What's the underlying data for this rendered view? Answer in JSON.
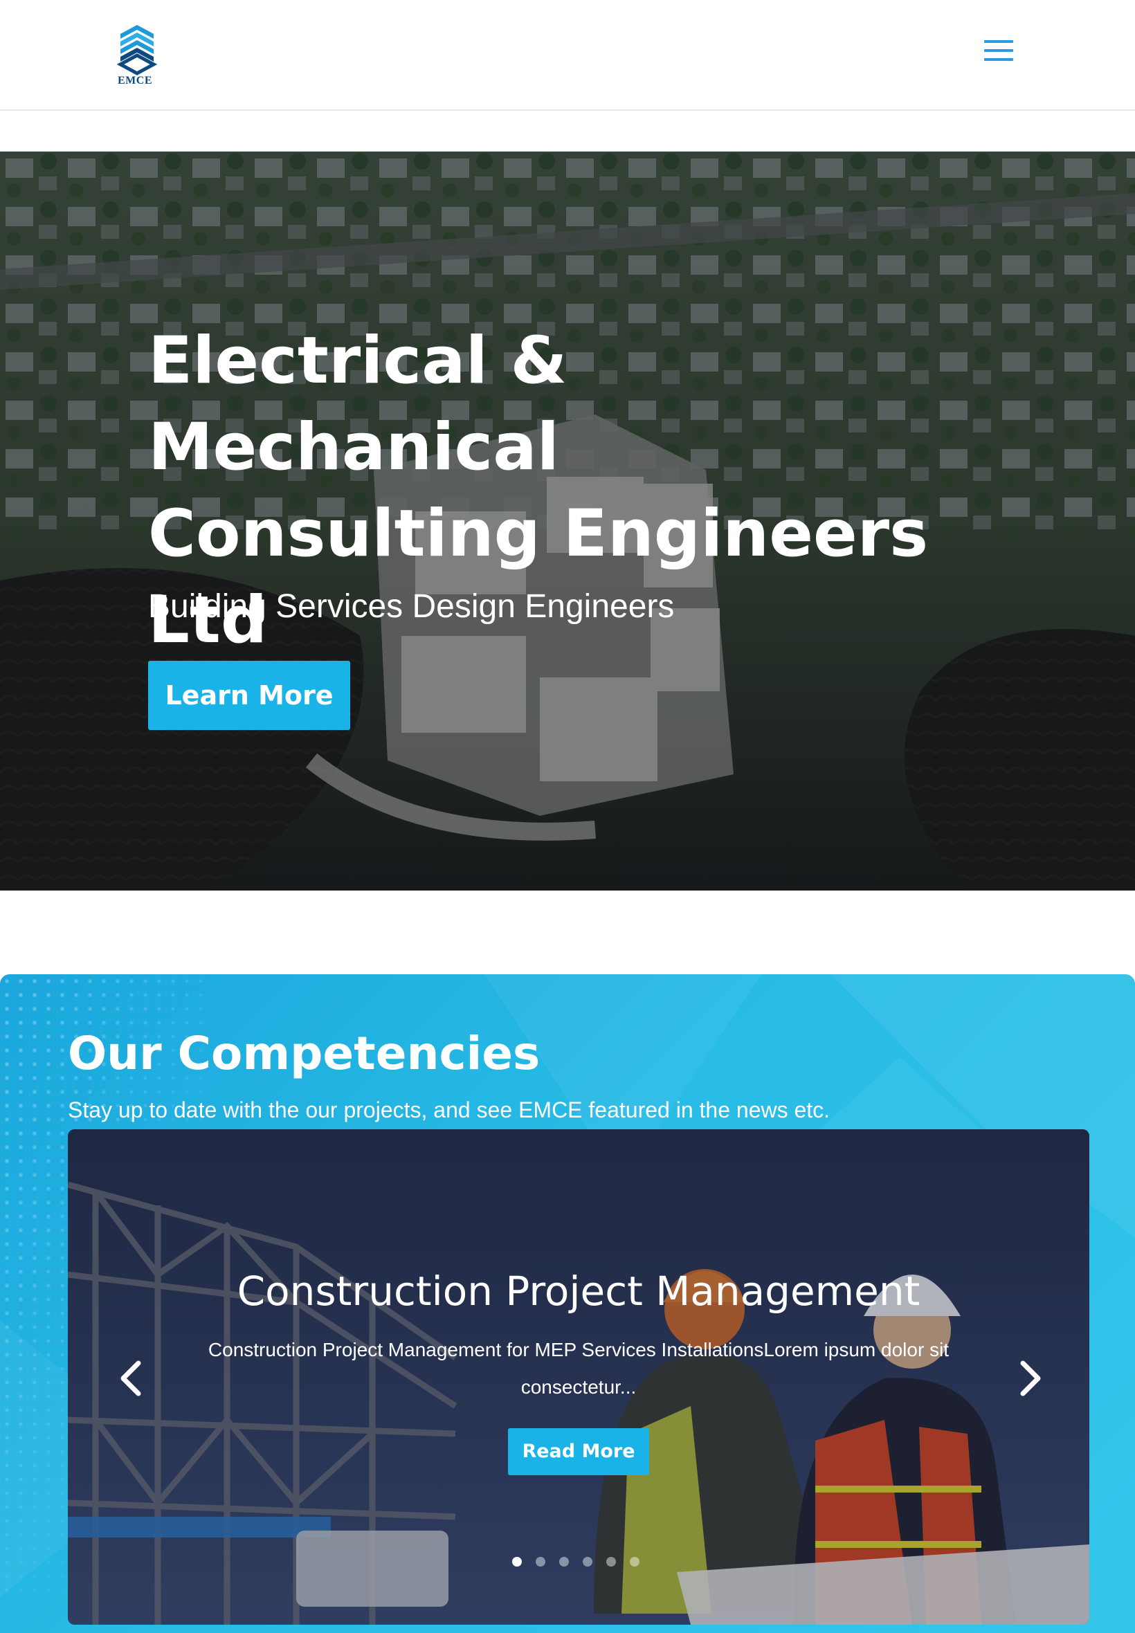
{
  "header": {
    "logo_text": "EMCE",
    "menu_icon": "hamburger-menu-icon"
  },
  "hero": {
    "title": "Electrical & Mechanical Consulting Engineers Ltd",
    "subtitle": "Building Services Design Engineers",
    "button_label": "Learn More"
  },
  "competencies": {
    "title": "Our Competencies",
    "subtitle": "Stay up to date with the our projects, and see EMCE featured in the news etc.",
    "slider": {
      "slide_title": "Construction Project Management",
      "slide_text": "Construction Project Management for MEP Services InstallationsLorem ipsum dolor sit consectetur...",
      "button_label": "Read More",
      "prev_icon": "chevron-left-icon",
      "next_icon": "chevron-right-icon",
      "slide_count": 6,
      "active_slide": 1
    }
  },
  "colors": {
    "accent": "#1ab3e8",
    "menu_icon": "#2a9be0",
    "logo_dark": "#0c4a80",
    "section_bg": "#28bce6"
  }
}
